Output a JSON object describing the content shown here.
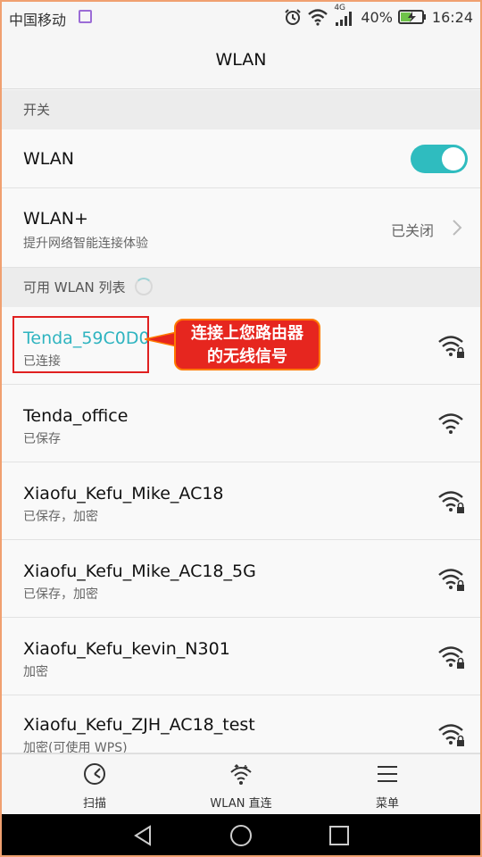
{
  "status_bar": {
    "carrier": "中国移动",
    "network_label": "4G",
    "battery": "40%",
    "time": "16:24"
  },
  "header": {
    "title": "WLAN"
  },
  "switch_section": {
    "header": "开关",
    "wlan_label": "WLAN",
    "wlan_enabled": true,
    "wlan_plus_label": "WLAN+",
    "wlan_plus_desc": "提升网络智能连接体验",
    "wlan_plus_status": "已关闭"
  },
  "networks_section": {
    "header": "可用 WLAN 列表",
    "networks": [
      {
        "ssid": "Tenda_59C0D0",
        "status": "已连接"
      },
      {
        "ssid": "Tenda_office",
        "status": "已保存"
      },
      {
        "ssid": "Xiaofu_Kefu_Mike_AC18",
        "status": "已保存，加密"
      },
      {
        "ssid": "Xiaofu_Kefu_Mike_AC18_5G",
        "status": "已保存，加密"
      },
      {
        "ssid": "Xiaofu_Kefu_kevin_N301",
        "status": "加密"
      },
      {
        "ssid": "Xiaofu_Kefu_ZJH_AC18_test",
        "status": "加密(可使用 WPS)"
      }
    ]
  },
  "annotation": {
    "line1": "连接上您路由器",
    "line2": "的无线信号"
  },
  "bottom_tabs": {
    "scan": "扫描",
    "wlan_direct": "WLAN 直连",
    "menu": "菜单"
  },
  "colors": {
    "accent": "#2fbcbf",
    "connected_text": "#2fb4c0",
    "callout_bg": "#e6261f",
    "highlight_border": "#e02020"
  }
}
